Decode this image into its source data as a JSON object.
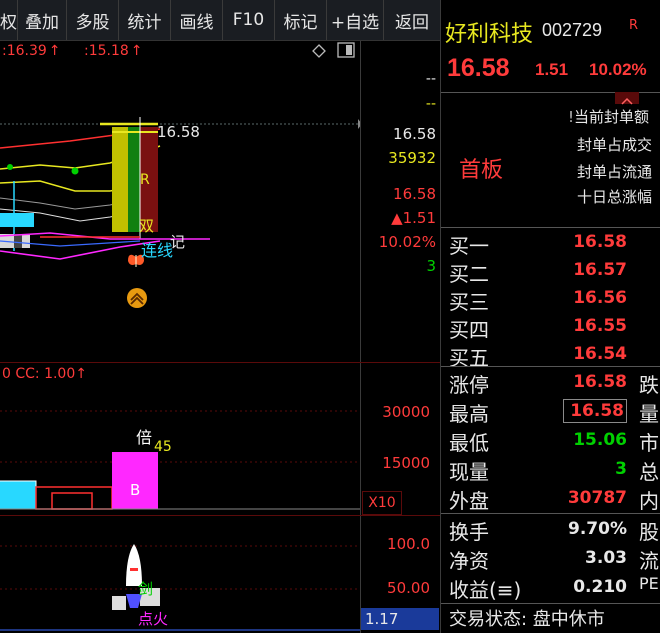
{
  "toolbar": {
    "items": [
      "权",
      "叠加",
      "多股",
      "统计",
      "画线",
      "F10",
      "标记",
      "+自选",
      "返回"
    ]
  },
  "chart": {
    "top_info": {
      "a": ":16.39",
      "b": ":15.18"
    },
    "price_label": "16.58",
    "label_r": "R",
    "label_shuang": "双",
    "label_lianxian": "连线",
    "label_ji": "记",
    "axis_right": {
      "v1": "--",
      "v2": "--",
      "price": "16.58",
      "volume": "35932",
      "price2": "16.58",
      "change": "▲1.51",
      "pct": "10.02%",
      "count": "3"
    },
    "vol_panel": {
      "label": "0 CC: 1.00",
      "tick_30000": "30000",
      "tick_15000": "15000",
      "unit": "X10",
      "bei": "倍",
      "num45": "45",
      "b_label": "B"
    },
    "ind_panel": {
      "tick_100": "100.0",
      "tick_50": "50.00",
      "jian": "剑",
      "dianhuo": "点火",
      "value": "1.17"
    }
  },
  "quote": {
    "name": "好利科技",
    "code": "002729",
    "r_mark": "R",
    "price": "16.58",
    "change": "1.51",
    "pct": "10.02%",
    "seal_lines": [
      "当前封单额",
      "封单占成交",
      "封单占流通",
      "十日总涨幅"
    ],
    "shouban": "首板",
    "bids": [
      {
        "label": "买一",
        "price": "16.58"
      },
      {
        "label": "买二",
        "price": "16.57"
      },
      {
        "label": "买三",
        "price": "16.56"
      },
      {
        "label": "买四",
        "price": "16.55"
      },
      {
        "label": "买五",
        "price": "16.54"
      }
    ],
    "stats": [
      {
        "label": "涨停",
        "value": "16.58",
        "color": "#ff3b3b",
        "side": "跌"
      },
      {
        "label": "最高",
        "value": "16.58",
        "color": "#ff3b3b",
        "side": "量"
      },
      {
        "label": "最低",
        "value": "15.06",
        "color": "#00d000",
        "side": "市"
      },
      {
        "label": "现量",
        "value": "3",
        "color": "#00d000",
        "side": "总"
      },
      {
        "label": "外盘",
        "value": "30787",
        "color": "#ff3b3b",
        "side": "内"
      }
    ],
    "stats2": [
      {
        "label": "换手",
        "value": "9.70%",
        "side": "股"
      },
      {
        "label": "净资",
        "value": "3.03",
        "side": "流"
      },
      {
        "label": "收益(≡)",
        "value": "0.210",
        "side": "PE"
      }
    ],
    "status": "交易状态: 盘中休市"
  },
  "colors": {
    "up": "#ff3b3b",
    "down": "#00d000",
    "yellow": "#e8e820",
    "cyan": "#28d8ff",
    "magenta": "#ff28ff"
  }
}
